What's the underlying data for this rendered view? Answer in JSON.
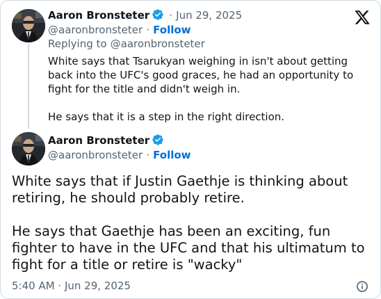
{
  "reply_tweet": {
    "author_name": "Aaron Bronsteter",
    "separator": "·",
    "date": "Jun 29, 2025",
    "handle": "@aaronbronsteter",
    "handle_separator": "·",
    "follow_label": "Follow",
    "replying_to_label": "Replying to",
    "replying_to_handle": "@aaronbronsteter",
    "paragraphs": [
      "White says that Tsarukyan weighing in isn't about getting back into the UFC's good graces, he had an opportunity to fight for the title and didn't weigh in.",
      "He says that it is a step in the right direction."
    ]
  },
  "main_tweet": {
    "author_name": "Aaron Bronsteter",
    "handle": "@aaronbronsteter",
    "handle_separator": "·",
    "follow_label": "Follow",
    "paragraphs": [
      "White says that if Justin Gaethje is thinking about retiring, he should probably retire.",
      "He says that Gaethje has been an exciting, fun fighter to have in the UFC and that his ultimatum to fight for a title or retire is \"wacky\""
    ],
    "timestamp": "5:40 AM · Jun 29, 2025"
  },
  "icons": {
    "brand_logo": "x-logo-icon",
    "verified": "verified-badge-icon",
    "info": "info-icon"
  },
  "colors": {
    "text": "#0f1419",
    "muted": "#536471",
    "link": "#006fd6",
    "verified": "#1d9bf0",
    "border": "#cfd9de"
  }
}
